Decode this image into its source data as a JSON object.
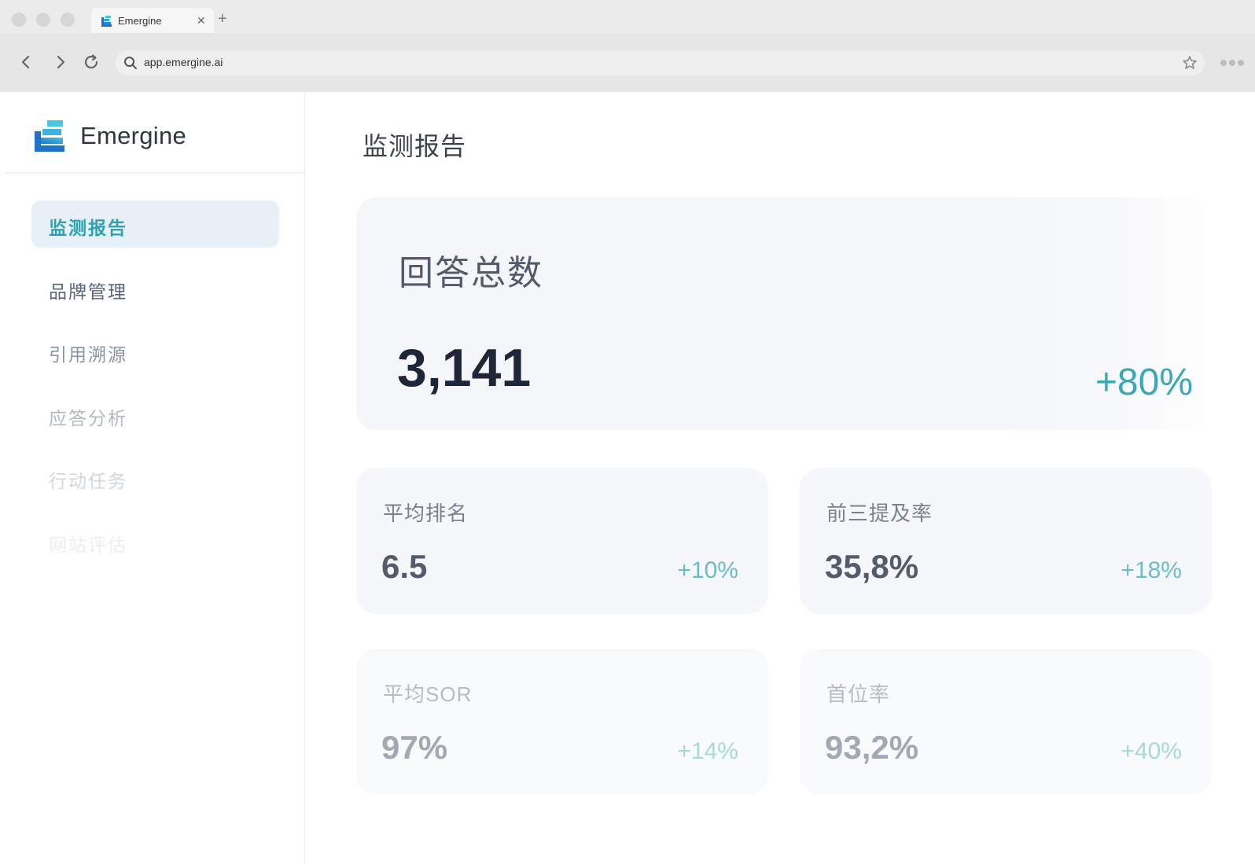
{
  "browser": {
    "tab_title": "Emergine",
    "tab_close": "✕",
    "new_tab": "+",
    "url": "app.emergine.ai"
  },
  "brand": {
    "name": "Emergine",
    "colors": {
      "logo_dark": "#1e73c8",
      "logo_light": "#46c6e0"
    }
  },
  "sidebar": {
    "items": [
      {
        "label": "监测报告",
        "active": true,
        "color": "#2ba3b5"
      },
      {
        "label": "品牌管理",
        "active": false,
        "color": "#5a6478"
      },
      {
        "label": "引用溯源",
        "active": false,
        "color": "#8a93a3"
      },
      {
        "label": "应答分析",
        "active": false,
        "color": "#b3b9c4"
      },
      {
        "label": "行动任务",
        "active": false,
        "color": "#d2d6dd"
      },
      {
        "label": "网站评估",
        "active": false,
        "color": "#eceef1"
      }
    ]
  },
  "main": {
    "title": "监测报告",
    "hero": {
      "label": "回答总数",
      "value": "3,141",
      "change": "+80%"
    },
    "cards": [
      {
        "label": "平均排名",
        "value": "6.5",
        "change": "+10%"
      },
      {
        "label": "前三提及率",
        "value": "35,8%",
        "change": "+18%"
      },
      {
        "label": "平均SOR",
        "value": "97%",
        "change": "+14%"
      },
      {
        "label": "首位率",
        "value": "93,2%",
        "change": "+40%"
      }
    ]
  },
  "colors": {
    "accent": "#3aa8b8",
    "text_dark": "#1e2638"
  }
}
